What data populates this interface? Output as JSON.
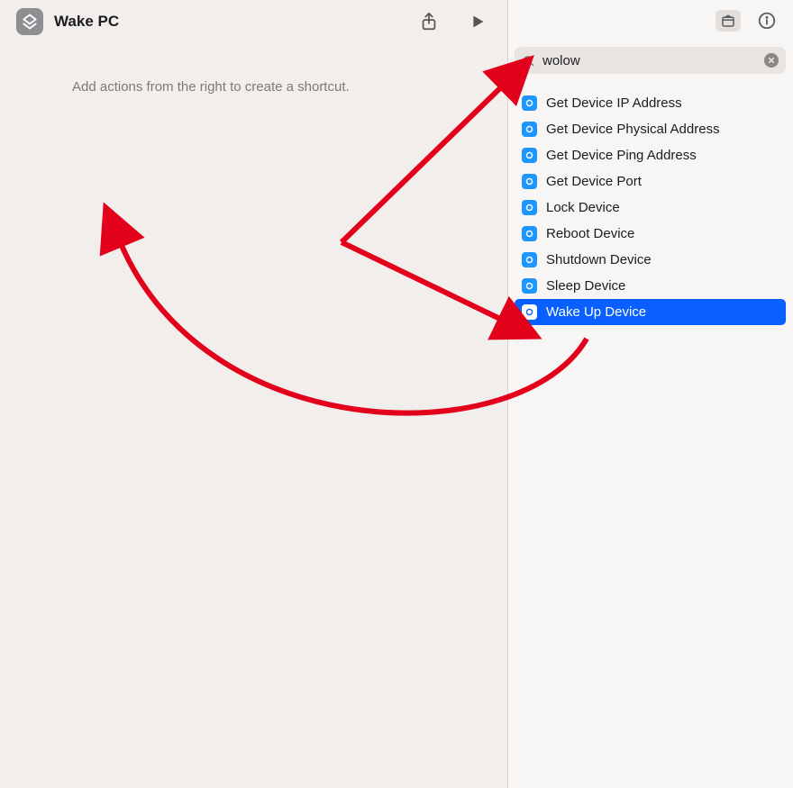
{
  "header": {
    "title": "Wake PC"
  },
  "canvas": {
    "hint": "Add actions from the right to create a shortcut."
  },
  "search": {
    "value": "wolow"
  },
  "actions": [
    {
      "label": "Get Device IP Address",
      "selected": false
    },
    {
      "label": "Get Device Physical Address",
      "selected": false
    },
    {
      "label": "Get Device Ping Address",
      "selected": false
    },
    {
      "label": "Get Device Port",
      "selected": false
    },
    {
      "label": "Lock Device",
      "selected": false
    },
    {
      "label": "Reboot Device",
      "selected": false
    },
    {
      "label": "Shutdown Device",
      "selected": false
    },
    {
      "label": "Sleep Device",
      "selected": false
    },
    {
      "label": "Wake Up Device",
      "selected": true
    }
  ],
  "annotations": {
    "arrow_color": "#e3001b"
  }
}
